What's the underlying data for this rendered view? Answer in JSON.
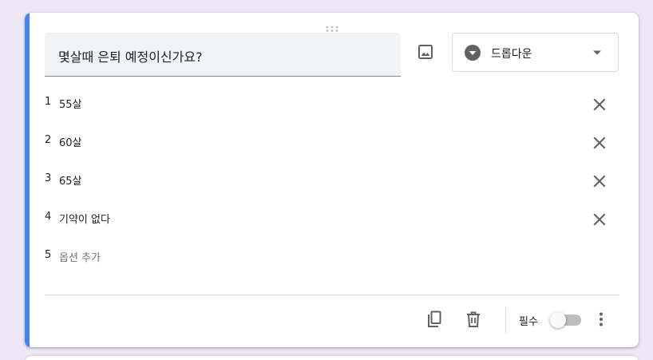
{
  "question": {
    "title": "몇살때 은퇴 예정이신가요?"
  },
  "question_type": {
    "label": "드롭다운",
    "icon": "dropdown-circle-icon"
  },
  "options": [
    {
      "number": "1",
      "label": "55살"
    },
    {
      "number": "2",
      "label": "60살"
    },
    {
      "number": "3",
      "label": "65살"
    },
    {
      "number": "4",
      "label": "기약이 없다"
    }
  ],
  "add_option": {
    "number": "5",
    "label": "옵션 추가"
  },
  "footer": {
    "required_label": "필수",
    "required_on": false
  },
  "colors": {
    "accent": "#4285f4",
    "background": "#ede7f6",
    "icon": "#5f6368"
  }
}
